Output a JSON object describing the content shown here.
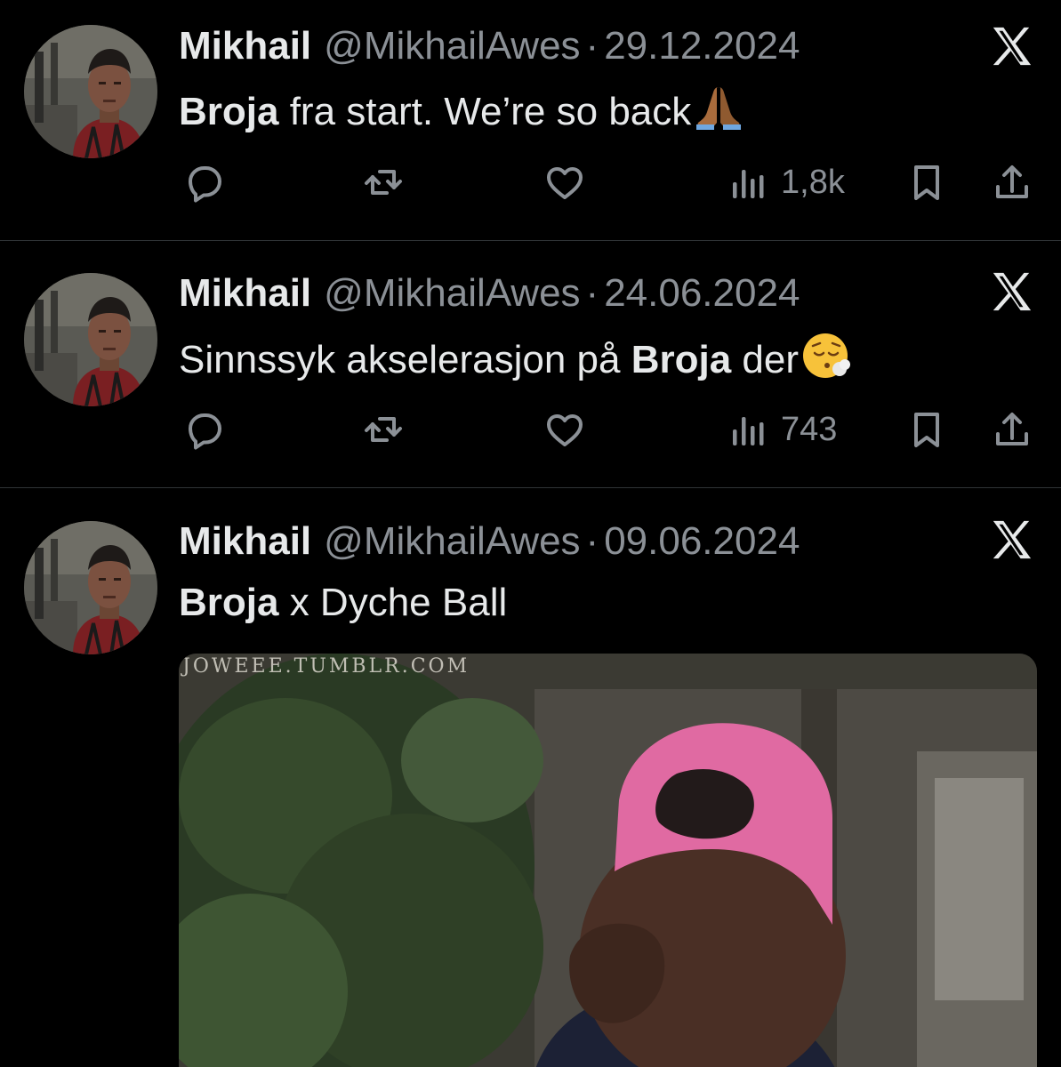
{
  "colors": {
    "background": "#000000",
    "text": "#e7e9ea",
    "muted": "#8b9096",
    "divider": "#2f3336"
  },
  "tweets": [
    {
      "name": "Mikhail",
      "handle": "@MikhailAwes",
      "separator": "·",
      "date": "29.12.2024",
      "text_bold": "Broja",
      "text_rest": " fra start. We’re so back",
      "emoji": "folded-hands",
      "views": "1,8k"
    },
    {
      "name": "Mikhail",
      "handle": "@MikhailAwes",
      "separator": "·",
      "date": "24.06.2024",
      "text_pre": "Sinnssyk akselerasjon på ",
      "text_bold": "Broja",
      "text_post": " der",
      "emoji": "face-exhaling",
      "views": "743"
    },
    {
      "name": "Mikhail",
      "handle": "@MikhailAwes",
      "separator": "·",
      "date": "09.06.2024",
      "text_bold": "Broja",
      "text_rest": " x Dyche Ball",
      "media_watermark": "JOWEEE.TUMBLR.COM"
    }
  ],
  "icons": [
    "reply-icon",
    "retweet-icon",
    "like-icon",
    "views-icon",
    "bookmark-icon",
    "share-icon",
    "x-logo-icon"
  ]
}
